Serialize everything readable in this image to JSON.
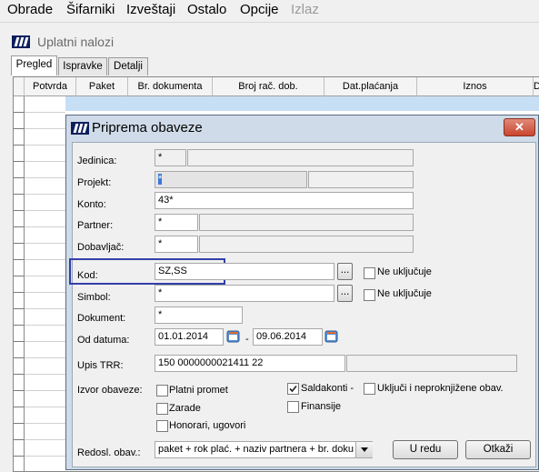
{
  "menu": [
    "Obrade",
    "Šifarniki",
    "Izveštaji",
    "Ostalo",
    "Opcije",
    "Izlaz"
  ],
  "window": {
    "title": "Uplatni nalozi"
  },
  "tabs": [
    "Pregled",
    "Ispravke",
    "Detalji"
  ],
  "grid_columns": [
    "Potvrda",
    "Paket",
    "Br. dokumenta",
    "Broj rač. dob.",
    "Dat.plaćanja",
    "Iznos",
    "D"
  ],
  "dialog": {
    "title": "Priprema obaveze",
    "close_symbol": "✕",
    "fields": {
      "jedinica": {
        "label": "Jedinica:",
        "value": "*"
      },
      "projekt": {
        "label": "Projekt:",
        "value": "*"
      },
      "konto": {
        "label": "Konto:",
        "value": "43*"
      },
      "partner": {
        "label": "Partner:",
        "value": "*"
      },
      "dobavljac": {
        "label": "Dobavljač:",
        "value": "*"
      },
      "kod": {
        "label": "Kod:",
        "value": "SZ,SS"
      },
      "simbol": {
        "label": "Simbol:",
        "value": "*"
      },
      "dokument": {
        "label": "Dokument:",
        "value": "*"
      },
      "od_datuma": {
        "label": "Od datuma:",
        "from": "01.01.2014",
        "separator": "-",
        "to": "09.06.2014"
      },
      "upis_trr": {
        "label": "Upis TRR:",
        "value": "150 0000000021411 22"
      }
    },
    "browse_label": "...",
    "ne_ukljucuje": "Ne uključuje",
    "izvor": {
      "label": "Izvor obaveze:",
      "platni_promet": "Platni promet",
      "zarade": "Zarade",
      "honorari": "Honorari, ugovori",
      "saldakonti": "Saldakonti -",
      "finansije": "Finansije",
      "ukljuci": "Uključi i neproknjižene obav."
    },
    "redosled": {
      "label": "Redosl. obav.:",
      "value": "paket + rok plać. + naziv partnera + br. doku"
    },
    "buttons": {
      "ok": "U redu",
      "cancel": "Otkaži"
    }
  },
  "colors": {
    "highlight_box": "#3340a8",
    "title_bar": "#cfdbe8",
    "close_button": "#c9452f",
    "logo": "#0b1f5c"
  },
  "checkbox_states": {
    "ne_ukljucuje_kod": false,
    "ne_ukljucuje_simbol": false,
    "platni_promet": false,
    "zarade": false,
    "honorari": false,
    "saldakonti": true,
    "finansije": false,
    "ukljuci": false
  }
}
